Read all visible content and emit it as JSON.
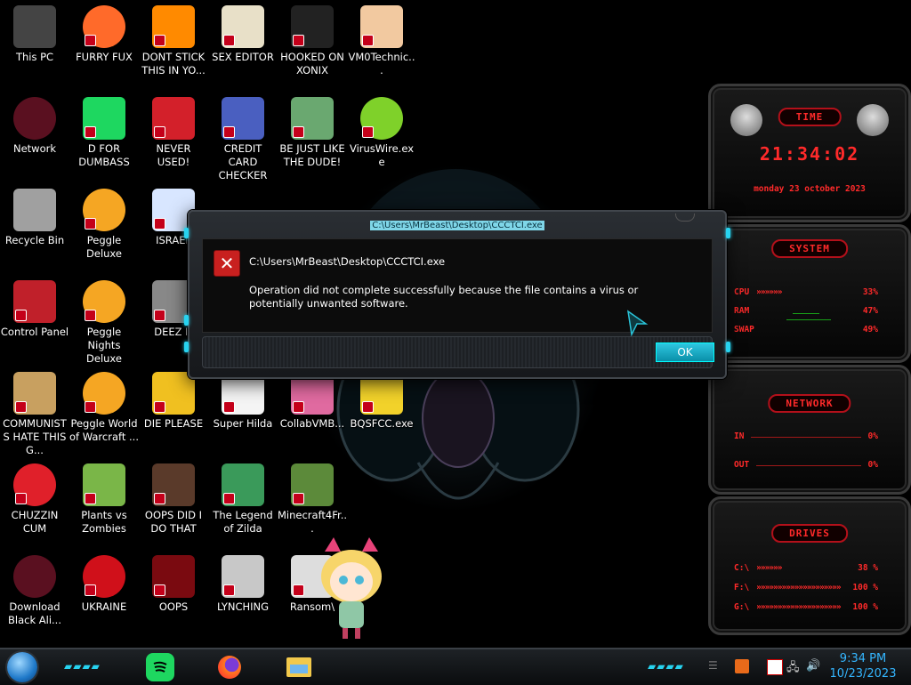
{
  "desktop": {
    "icons": [
      {
        "label": "This PC",
        "icon": "computer-icon"
      },
      {
        "label": "FURRY FUX",
        "icon": "firefox-icon"
      },
      {
        "label": "DONT STICK THIS IN YO...",
        "icon": "traffic-cone-icon"
      },
      {
        "label": "SEX EDITOR",
        "icon": "hex-editor-icon"
      },
      {
        "label": "HOOKED ON XONIX",
        "icon": "xonix-game-icon"
      },
      {
        "label": "VM0Technic...",
        "icon": "doctor-icon"
      },
      {
        "label": "Network",
        "icon": "alien-network-icon"
      },
      {
        "label": "D FOR DUMBASS",
        "icon": "spotify-icon"
      },
      {
        "label": "NEVER USED!",
        "icon": "dev-icon"
      },
      {
        "label": "CREDIT CARD CHECKER",
        "icon": "credit-card-icon"
      },
      {
        "label": "BE JUST LIKE THE DUDE!",
        "icon": "elf-santa-icon"
      },
      {
        "label": "VirusWire.exe",
        "icon": "lime-icon"
      },
      {
        "label": "Recycle Bin",
        "icon": "recycle-bin-icon"
      },
      {
        "label": "Peggle Deluxe",
        "icon": "peggle-icon"
      },
      {
        "label": "ISRAEL",
        "icon": "flag-icon"
      },
      {
        "label": "Control Panel",
        "icon": "control-panel-icon"
      },
      {
        "label": "Peggle Nights Deluxe",
        "icon": "peggle-icon"
      },
      {
        "label": "DEEZ N",
        "icon": "windows-stack-icon"
      },
      {
        "label": "COMMUNISTS HATE THIS G...",
        "icon": "money-bag-icon"
      },
      {
        "label": "Peggle World of Warcraft ...",
        "icon": "peggle-icon"
      },
      {
        "label": "DIE PLEASE",
        "icon": "adobe-de-icon"
      },
      {
        "label": "Super Hilda",
        "icon": "pixel-character-icon"
      },
      {
        "label": "CollabVMB...",
        "icon": "monitor-icon"
      },
      {
        "label": "BQSFCC.exe",
        "icon": "padlock-icon"
      },
      {
        "label": "CHUZZIN CUM",
        "icon": "chuzzle-icon"
      },
      {
        "label": "Plants vs Zombies",
        "icon": "plant-icon"
      },
      {
        "label": "OOPS DID I DO THAT",
        "icon": "portrait-icon"
      },
      {
        "label": "The Legend of Zilda",
        "icon": "zelda-icon"
      },
      {
        "label": "Minecraft4Fr...",
        "icon": "minecraft-icon"
      },
      {
        "label": "Download Black Ali...",
        "icon": "alien-network-icon"
      },
      {
        "label": "UKRAINE",
        "icon": "radiation-icon"
      },
      {
        "label": "OOPS",
        "icon": "red-screen-icon"
      },
      {
        "label": "LYNCHING",
        "icon": "fence-icon"
      },
      {
        "label": "Ransom\\",
        "icon": "skull-icon"
      }
    ]
  },
  "dialog": {
    "caption": "C:\\Users\\MrBeast\\Desktop\\CCCTCI.exe",
    "path": "C:\\Users\\MrBeast\\Desktop\\CCCTCI.exe",
    "message": "Operation did not complete successfully because the file contains a virus or potentially unwanted software.",
    "ok_label": "OK",
    "icon": "error-icon"
  },
  "gadgets": {
    "time": {
      "title": "TIME",
      "clock": "21:34:02",
      "date": "monday 23 october 2023"
    },
    "system": {
      "title": "SYSTEM",
      "rows": [
        {
          "label": "CPU",
          "bar": "»»»»»»",
          "value": "33%"
        },
        {
          "label": "RAM",
          "bar": "",
          "value": "47%"
        },
        {
          "label": "SWAP",
          "bar": "",
          "value": "49%"
        }
      ]
    },
    "network": {
      "title": "NETWORK",
      "rows": [
        {
          "label": "IN",
          "value": "0%"
        },
        {
          "label": "OUT",
          "value": "0%"
        }
      ]
    },
    "drives": {
      "title": "DRIVES",
      "rows": [
        {
          "label": "C:\\",
          "bar": "»»»»»»",
          "value": "38 %"
        },
        {
          "label": "F:\\",
          "bar": "»»»»»»»»»»»»»»»»»»»»",
          "value": "100 %"
        },
        {
          "label": "G:\\",
          "bar": "»»»»»»»»»»»»»»»»»»»»",
          "value": "100 %"
        }
      ]
    }
  },
  "taskbar": {
    "pinned": [
      {
        "name": "spotify",
        "icon": "spotify-icon"
      },
      {
        "name": "firefox",
        "icon": "firefox-icon"
      },
      {
        "name": "file explorer",
        "icon": "folder-icon"
      }
    ],
    "clock_time": "9:34 PM",
    "clock_date": "10/23/2023",
    "accent": "#27d3f0"
  }
}
